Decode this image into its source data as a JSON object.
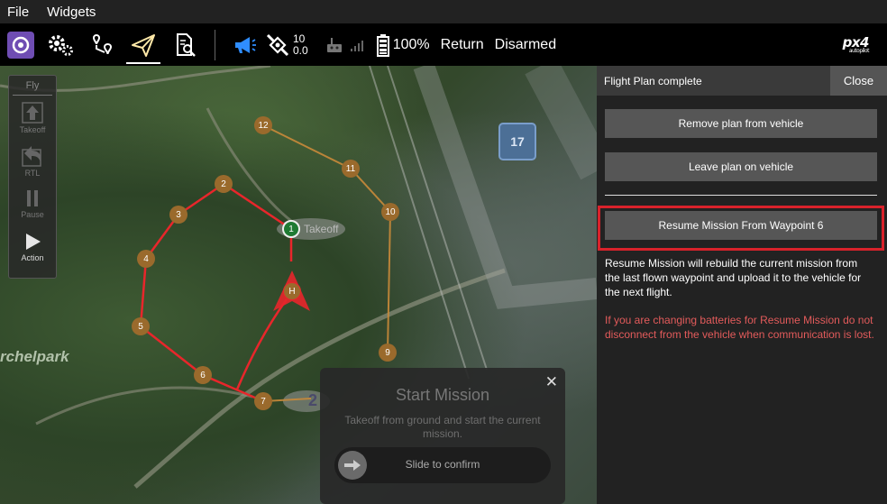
{
  "menu": {
    "file": "File",
    "widgets": "Widgets"
  },
  "toolbar": {
    "sat_count": "10",
    "hdop": "0.0",
    "battery": "100%",
    "flight_mode": "Return",
    "arm_state": "Disarmed",
    "brand": "px4",
    "brand_sub": "autopilot"
  },
  "fly_panel": {
    "title": "Fly",
    "items": [
      {
        "label": "Takeoff",
        "icon": "takeoff-icon"
      },
      {
        "label": "RTL",
        "icon": "rtl-icon"
      },
      {
        "label": "Pause",
        "icon": "pause-icon"
      },
      {
        "label": "Action",
        "icon": "play-icon"
      }
    ]
  },
  "map": {
    "park_label": "rchelpark",
    "takeoff_label": "Takeoff",
    "home_label": "H",
    "building_marker": "17",
    "waypoints": [
      "1",
      "2",
      "3",
      "4",
      "5",
      "6",
      "7",
      "9",
      "10",
      "11",
      "12"
    ],
    "partial_marker": "2"
  },
  "start_mission": {
    "title": "Start Mission",
    "description": "Takeoff from ground and start the current mission.",
    "slider_label": "Slide to confirm",
    "close": "✕"
  },
  "plan_panel": {
    "title": "Flight Plan complete",
    "close": "Close",
    "remove_button": "Remove plan from vehicle",
    "leave_button": "Leave plan on vehicle",
    "resume_button": "Resume Mission From Waypoint 6",
    "info_text": "Resume Mission will rebuild the current mission from the last flown waypoint and upload it to the vehicle for the next flight.",
    "warning_text": "If you are changing batteries for Resume Mission do not disconnect from the vehicle when communication is lost."
  },
  "colors": {
    "highlight": "#d9222b",
    "mission_path": "#e8262b",
    "future_path": "#c98a3a",
    "waypoint_fill": "#9a6a2c",
    "takeoff_fill": "#1f7a33",
    "warning_text": "#e35b5b",
    "qgc_logo": "#6f4db3"
  }
}
